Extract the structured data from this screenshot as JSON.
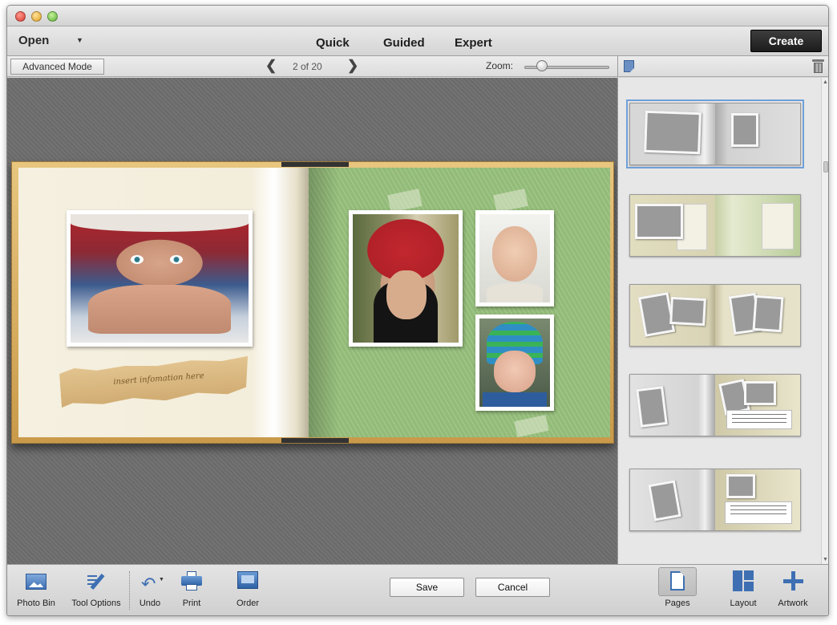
{
  "header": {
    "open_label": "Open",
    "modes": [
      "Quick",
      "Guided",
      "Expert"
    ],
    "create_label": "Create"
  },
  "options": {
    "advanced_mode_label": "Advanced Mode",
    "page_indicator": "2 of 20",
    "zoom_label": "Zoom:",
    "zoom_level": 0.2
  },
  "canvas": {
    "caption_placeholder": "insert infomation here"
  },
  "layouts_panel": {
    "selected_index": 0,
    "thumbnail_count": 5
  },
  "bottom_toolbar": {
    "left_tools": [
      "Photo Bin",
      "Tool Options",
      "Undo",
      "Print",
      "Order"
    ],
    "save_label": "Save",
    "cancel_label": "Cancel",
    "right_tools": [
      "Pages",
      "Layout",
      "Artwork"
    ]
  },
  "colors": {
    "accent_blue": "#6fa0d8",
    "right_page_green": "#97c07c",
    "left_page_cream": "#f5f0e0",
    "book_border_gold": "#d8b064",
    "create_button": "#222222"
  }
}
